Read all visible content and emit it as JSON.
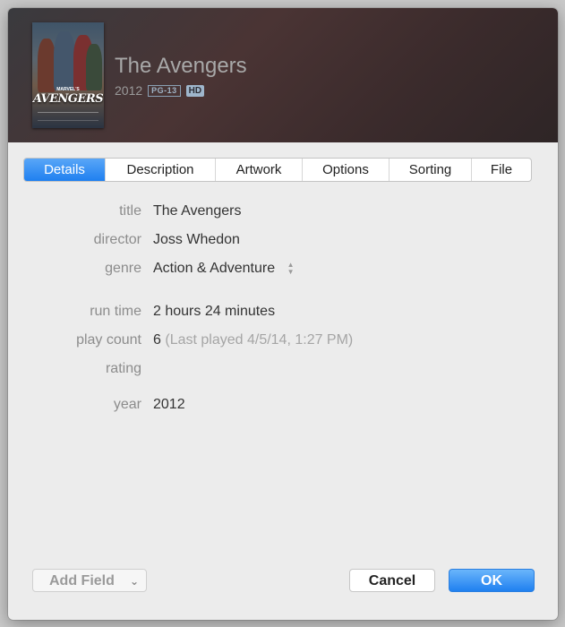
{
  "header": {
    "movie_title": "The Avengers",
    "year": "2012",
    "rating_badge": "PG-13",
    "hd_badge": "HD",
    "poster": {
      "pre_title": "MARVEL'S",
      "title": "AVENGERS"
    }
  },
  "tabs": [
    {
      "label": "Details",
      "active": true
    },
    {
      "label": "Description",
      "active": false
    },
    {
      "label": "Artwork",
      "active": false
    },
    {
      "label": "Options",
      "active": false
    },
    {
      "label": "Sorting",
      "active": false
    },
    {
      "label": "File",
      "active": false
    }
  ],
  "fields": {
    "title": {
      "label": "title",
      "value": "The Avengers"
    },
    "director": {
      "label": "director",
      "value": "Joss Whedon"
    },
    "genre": {
      "label": "genre",
      "value": "Action & Adventure"
    },
    "run_time": {
      "label": "run time",
      "value": "2 hours 24 minutes"
    },
    "play_count": {
      "label": "play count",
      "value": "6",
      "note": "(Last played 4/5/14, 1:27 PM)"
    },
    "rating": {
      "label": "rating",
      "value": ""
    },
    "year": {
      "label": "year",
      "value": "2012"
    }
  },
  "footer": {
    "add_field_label": "Add Field",
    "cancel_label": "Cancel",
    "ok_label": "OK"
  },
  "colors": {
    "accent": "#1f80f0",
    "header_bg": "#3b2b2c",
    "window_bg": "#ececec"
  }
}
